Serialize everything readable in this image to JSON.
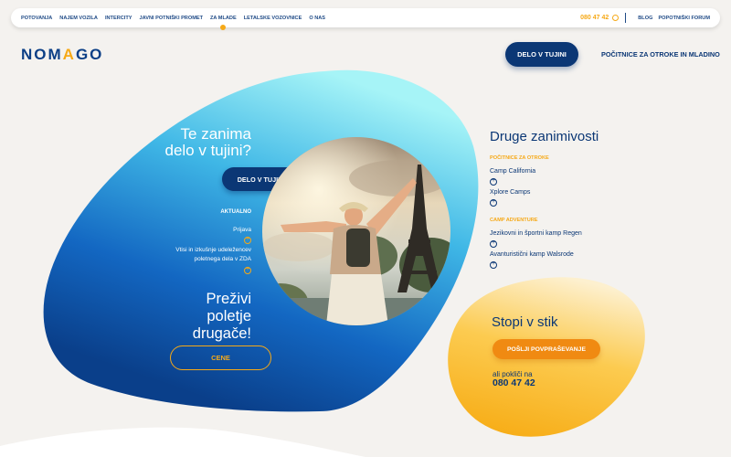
{
  "nav": {
    "items": [
      {
        "label": "POTOVANJA",
        "active": false
      },
      {
        "label": "NAJEM VOZILA",
        "active": false
      },
      {
        "label": "INTERCITY",
        "active": false
      },
      {
        "label": "JAVNI POTNIŠKI PROMET",
        "active": false
      },
      {
        "label": "ZA MLADE",
        "active": true
      },
      {
        "label": "LETALSKE VOZOVNICE",
        "active": false
      },
      {
        "label": "O NAS",
        "active": false
      }
    ],
    "phone": "080 47 42",
    "blog": "BLOG",
    "forum": "POPOTNIŠKI FORUM"
  },
  "header": {
    "logo_pre": "NOM",
    "logo_accent": "A",
    "logo_post": "GO",
    "primary_button": "DELO V TUJINI",
    "secondary_link": "POČITNICE ZA OTROKE IN MLADINO"
  },
  "hero": {
    "title_line1": "Te zanima",
    "title_line2": "delo v tujini?",
    "button": "DELO V TUJINI",
    "news_heading": "AKTUALNO",
    "news": [
      {
        "line1": "Prijava",
        "line2": ""
      },
      {
        "line1": "Vtisi in izkušnje udeležencev",
        "line2": "poletnega dela v ZDA"
      }
    ],
    "slogan_line1": "Preživi",
    "slogan_line2": "poletje",
    "slogan_line3": "drugače!",
    "prices_button": "CENE"
  },
  "other": {
    "title": "Druge zanimivosti",
    "groups": [
      {
        "category": "POČITNICE ZA OTROKE",
        "links": [
          "Camp California",
          "Xplore Camps"
        ]
      },
      {
        "category": "CAMP ADVENTURE",
        "links": [
          "Jezikovni in športni kamp Regen",
          "Avanturistični kamp Walsrode"
        ]
      }
    ]
  },
  "contact": {
    "title": "Stopi v stik",
    "button": "POŠLJI POVPRAŠEVANJE",
    "note": "ali pokliči na",
    "phone": "080 47 42"
  },
  "colors": {
    "navy": "#0b3775",
    "orange": "#f6a917",
    "cyan": "#9ff2f6",
    "blue": "#1566c4"
  }
}
